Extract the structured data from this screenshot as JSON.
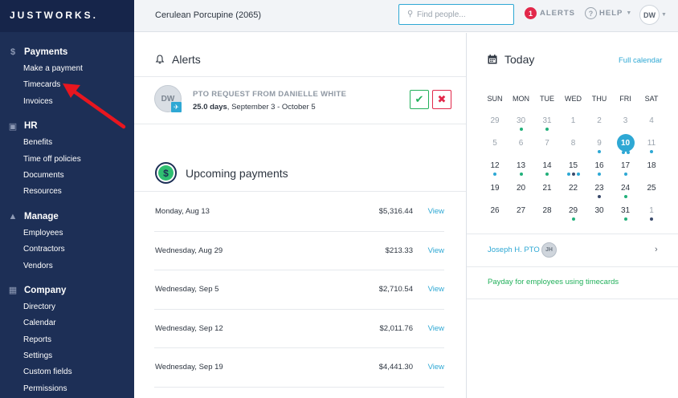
{
  "brand": {
    "logo": "JUSTWORKS."
  },
  "topbar": {
    "company": "Cerulean Porcupine (2065)",
    "search_placeholder": "Find people...",
    "alerts_count": "1",
    "alerts_label": "ALERTS",
    "help_label": "HELP",
    "user_initials": "DW"
  },
  "sidebar": {
    "sections": [
      {
        "title": "Payments",
        "icon": "dollar-icon",
        "items": [
          "Make a payment",
          "Timecards",
          "Invoices"
        ]
      },
      {
        "title": "HR",
        "icon": "briefcase-icon",
        "items": [
          "Benefits",
          "Time off policies",
          "Documents",
          "Resources"
        ]
      },
      {
        "title": "Manage",
        "icon": "people-icon",
        "items": [
          "Employees",
          "Contractors",
          "Vendors"
        ]
      },
      {
        "title": "Company",
        "icon": "building-icon",
        "items": [
          "Directory",
          "Calendar",
          "Reports",
          "Settings",
          "Custom fields",
          "Permissions"
        ]
      }
    ]
  },
  "alerts": {
    "title": "Alerts",
    "item": {
      "initials": "DW",
      "heading": "PTO REQUEST FROM DANIELLE WHITE",
      "days": "25.0 days",
      "range": ", September 3 - October 5"
    }
  },
  "payments": {
    "title": "Upcoming payments",
    "view_label": "View",
    "rows": [
      {
        "date": "Monday, Aug 13",
        "amount": "$5,316.44"
      },
      {
        "date": "Wednesday, Aug 29",
        "amount": "$213.33"
      },
      {
        "date": "Wednesday, Sep 5",
        "amount": "$2,710.54"
      },
      {
        "date": "Wednesday, Sep 12",
        "amount": "$2,011.76"
      },
      {
        "date": "Wednesday, Sep 19",
        "amount": "$4,441.30"
      }
    ]
  },
  "today": {
    "title": "Today",
    "full_calendar": "Full calendar",
    "weekdays": [
      "SUN",
      "MON",
      "TUE",
      "WED",
      "THU",
      "FRI",
      "SAT"
    ],
    "weeks": [
      [
        {
          "d": "29",
          "m": true
        },
        {
          "d": "30",
          "m": true,
          "dots": [
            "green"
          ]
        },
        {
          "d": "31",
          "m": true,
          "dots": [
            "green"
          ]
        },
        {
          "d": "1",
          "m": true
        },
        {
          "d": "2",
          "m": true
        },
        {
          "d": "3",
          "m": true
        },
        {
          "d": "4",
          "m": true
        }
      ],
      [
        {
          "d": "5",
          "m": true
        },
        {
          "d": "6",
          "m": true
        },
        {
          "d": "7",
          "m": true
        },
        {
          "d": "8",
          "m": true
        },
        {
          "d": "9",
          "m": true,
          "dots": [
            "blue"
          ]
        },
        {
          "d": "10",
          "today": true,
          "dots": [
            "blue",
            "blue"
          ]
        },
        {
          "d": "11",
          "m": true,
          "dots": [
            "blue"
          ]
        }
      ],
      [
        {
          "d": "12",
          "dots": [
            "blue"
          ]
        },
        {
          "d": "13",
          "dots": [
            "green"
          ]
        },
        {
          "d": "14",
          "dots": [
            "green"
          ]
        },
        {
          "d": "15",
          "dots": [
            "blue",
            "navy",
            "blue"
          ]
        },
        {
          "d": "16",
          "dots": [
            "blue"
          ]
        },
        {
          "d": "17",
          "dots": [
            "blue"
          ]
        },
        {
          "d": "18"
        }
      ],
      [
        {
          "d": "19"
        },
        {
          "d": "20"
        },
        {
          "d": "21"
        },
        {
          "d": "22"
        },
        {
          "d": "23",
          "dots": [
            "navy"
          ]
        },
        {
          "d": "24",
          "dots": [
            "green"
          ]
        },
        {
          "d": "25"
        }
      ],
      [
        {
          "d": "26"
        },
        {
          "d": "27"
        },
        {
          "d": "28"
        },
        {
          "d": "29",
          "dots": [
            "green"
          ]
        },
        {
          "d": "30"
        },
        {
          "d": "31",
          "dots": [
            "green"
          ]
        },
        {
          "d": "1",
          "m": true,
          "dots": [
            "navy"
          ]
        }
      ]
    ],
    "events": [
      {
        "label": "Joseph H. PTO",
        "initials": "JH"
      },
      {
        "label": "Payday for employees using timecards"
      }
    ]
  },
  "colors": {
    "sidebar": "#1d2f56",
    "accent": "#2ea8d4",
    "green": "#22b05b",
    "red": "#e2284a"
  }
}
